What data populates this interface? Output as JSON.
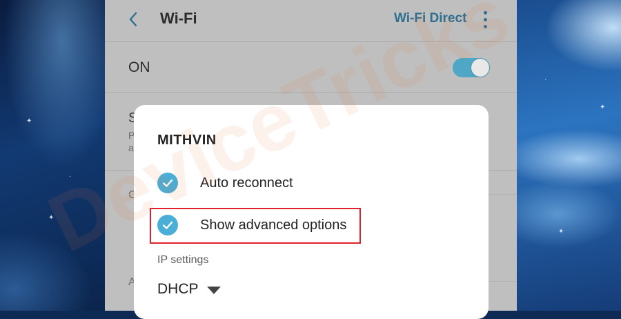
{
  "appbar": {
    "back_icon": "chevron-left-icon",
    "title": "Wi-Fi",
    "action_label": "Wi-Fi Direct",
    "more_icon": "more-vertical-icon",
    "accent_color": "#2e6f8f"
  },
  "wifi_toggle": {
    "label": "ON",
    "state": "on",
    "color": "#4fa7c6"
  },
  "background_peek": {
    "row1_initial": "S",
    "row1_sub_a": "P",
    "row1_sub_b": "a",
    "row2_initial": "C",
    "row3_initial": "A"
  },
  "dialog": {
    "title": "MITHVIN",
    "options": [
      {
        "label": "Auto reconnect",
        "checked": true,
        "icon": "check-circle-icon"
      },
      {
        "label": "Show advanced options",
        "checked": true,
        "icon": "check-circle-icon",
        "highlighted": true
      }
    ],
    "ip_section_label": "IP settings",
    "ip_mode": "DHCP",
    "ip_mode_icon": "dropdown-arrow-icon",
    "check_color": "#4aaed6",
    "highlight_color": "#e0202a"
  },
  "watermark": "DeviceTricks"
}
